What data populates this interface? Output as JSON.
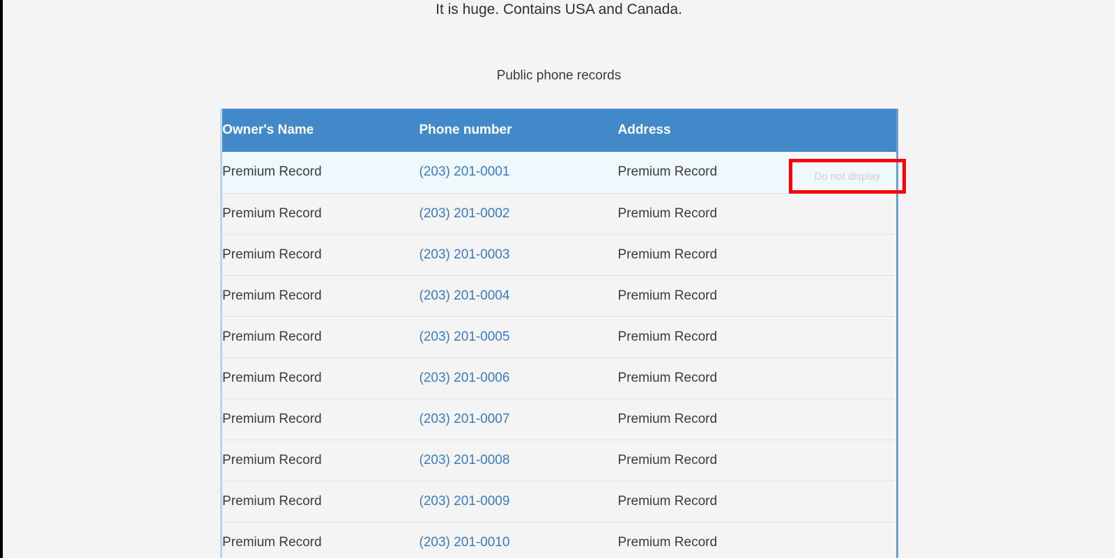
{
  "page": {
    "background_color": "#f4f4f4",
    "intro_text": "It is huge. Contains USA and Canada.",
    "section_title": "Public phone records"
  },
  "table": {
    "accent_color": "#4189c8",
    "link_color": "#3a7ac0",
    "row_color": "#f4f4f4",
    "highlighted_row_color": "#eef8fd",
    "columns": [
      {
        "key": "name",
        "label": "Owner's Name"
      },
      {
        "key": "phone",
        "label": "Phone number"
      },
      {
        "key": "address",
        "label": "Address"
      }
    ],
    "rows": [
      {
        "name": "Premium Record",
        "phone": "(203) 201-0001",
        "address": "Premium Record"
      },
      {
        "name": "Premium Record",
        "phone": "(203) 201-0002",
        "address": "Premium Record"
      },
      {
        "name": "Premium Record",
        "phone": "(203) 201-0003",
        "address": "Premium Record"
      },
      {
        "name": "Premium Record",
        "phone": "(203) 201-0004",
        "address": "Premium Record"
      },
      {
        "name": "Premium Record",
        "phone": "(203) 201-0005",
        "address": "Premium Record"
      },
      {
        "name": "Premium Record",
        "phone": "(203) 201-0006",
        "address": "Premium Record"
      },
      {
        "name": "Premium Record",
        "phone": "(203) 201-0007",
        "address": "Premium Record"
      },
      {
        "name": "Premium Record",
        "phone": "(203) 201-0008",
        "address": "Premium Record"
      },
      {
        "name": "Premium Record",
        "phone": "(203) 201-0009",
        "address": "Premium Record"
      },
      {
        "name": "Premium Record",
        "phone": "(203) 201-0010",
        "address": "Premium Record"
      }
    ]
  },
  "annotation": {
    "label": "Do not display",
    "border_color": "#fb0007",
    "text_color": "#cfcfcf"
  }
}
